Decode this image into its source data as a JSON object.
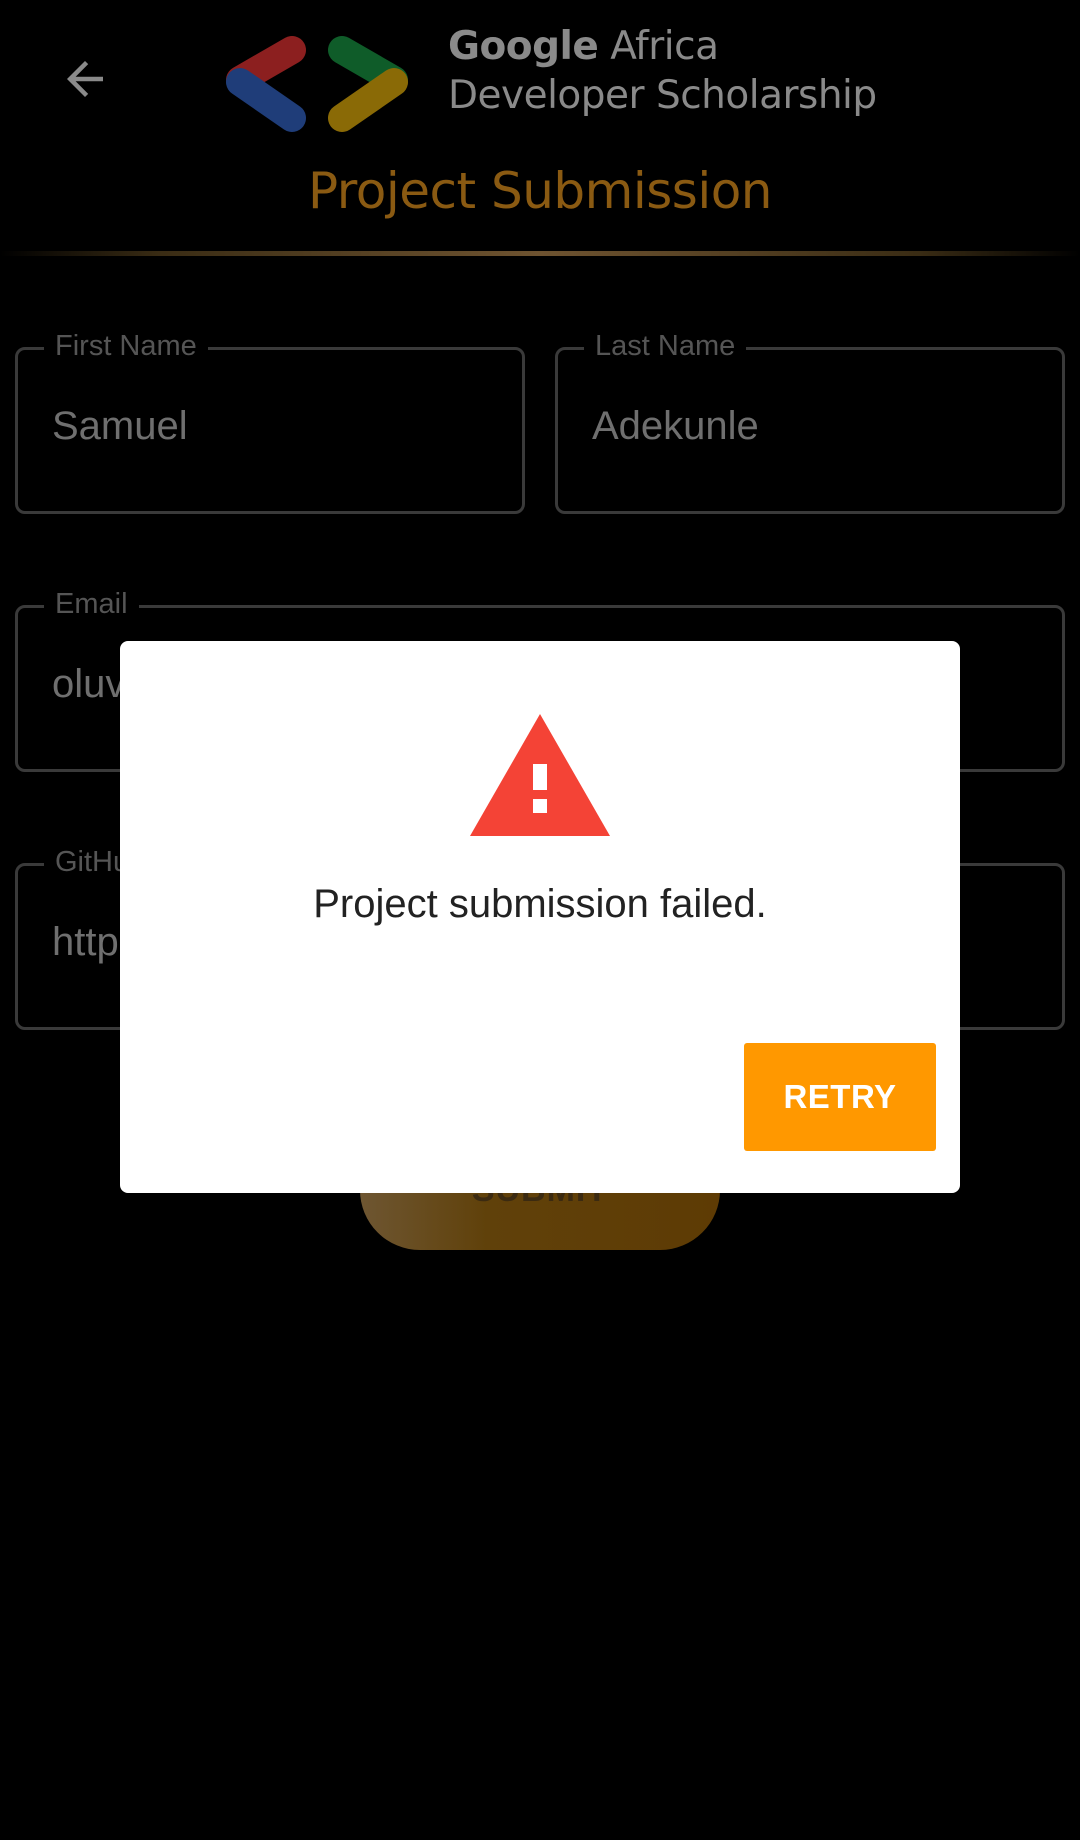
{
  "header": {
    "back_icon": "arrow-left-icon",
    "logo": {
      "icon": "code-brackets-logo-icon",
      "brand": "Google",
      "line1_rest": " Africa",
      "line2": "Developer Scholarship"
    },
    "title": "Project Submission"
  },
  "form": {
    "first_name": {
      "label": "First Name",
      "value": "Samuel"
    },
    "last_name": {
      "label": "Last Name",
      "value": "Adekunle"
    },
    "email": {
      "label": "Email",
      "value": "oluv"
    },
    "github": {
      "label": "GitHu",
      "value": "http"
    },
    "submit_label": "SUBMIT"
  },
  "dialog": {
    "icon": "warning-triangle-icon",
    "message": "Project submission failed.",
    "retry_label": "RETRY"
  },
  "colors": {
    "accent": "#ff9800",
    "title": "#8a5a12",
    "warning": "#f44336",
    "logo_red": "#8c1f1f",
    "logo_blue": "#1f3d79",
    "logo_green": "#0f5c29",
    "logo_yellow": "#8a6a06"
  }
}
